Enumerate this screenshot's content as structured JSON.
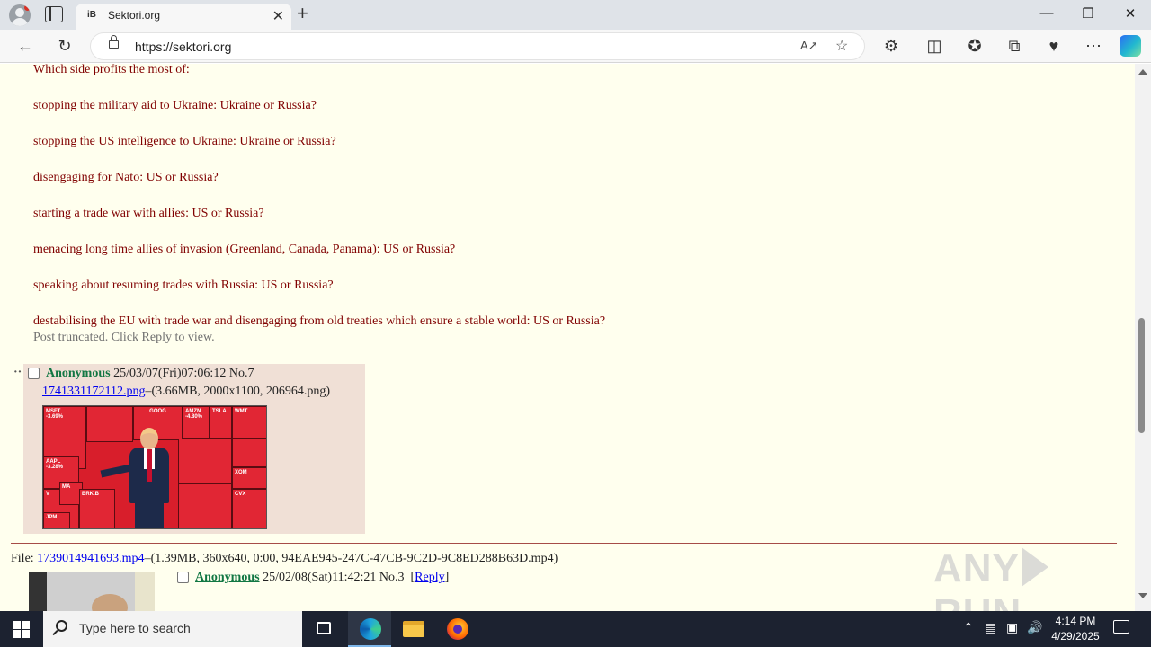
{
  "browser": {
    "tab_title": "Sektori.org",
    "tab_favicon": "iB",
    "url": "https://sektori.org",
    "new_tab_symbol": "+",
    "close_symbol": "✕"
  },
  "post": {
    "lines": [
      "Which side profits the most of:",
      "stopping the military aid to Ukraine: Ukraine or Russia?",
      "stopping the US intelligence to Ukraine: Ukraine or Russia?",
      "disengaging for Nato: US or Russia?",
      "starting a trade war with allies: US or Russia?",
      "menacing long time allies of invasion (Greenland, Canada, Panama): US or Russia?",
      "speaking about resuming trades with Russia: US or Russia?",
      "destabilising the EU with trade war and disengaging from old treaties which ensure a stable world: US or Russia?"
    ],
    "truncated_note": "Post truncated. Click Reply to view."
  },
  "reply_post": {
    "marker": "··",
    "name": "Anonymous",
    "datetime": "25/03/07(Fri)07:06:12",
    "number": "No.7",
    "file_name": "1741331172112.png",
    "file_info": "–(3.66MB, 2000x1100, 206964.png)",
    "thumb_labels": [
      "MSFT",
      "-3.69%",
      "GOOG",
      "AMZN",
      "-4.80%",
      "TSLA",
      "AAPL",
      "-3.28%",
      "MA",
      "V",
      "XOM",
      "CVX",
      "JPM",
      "BRK.B",
      "WMT"
    ]
  },
  "next_thread": {
    "file_label": "File:",
    "file_name": "1739014941693.mp4",
    "file_info": "–(1.39MB, 360x640, 0:00, 94EAE945-247C-47CB-9C2D-9C8ED288B63D.mp4)",
    "name": "Anonymous",
    "datetime": "25/02/08(Sat)11:42:21",
    "number": "No.3",
    "reply_link": "Reply"
  },
  "watermark": {
    "left": "ANY",
    "right": "RUN"
  },
  "taskbar": {
    "search_placeholder": "Type here to search",
    "time": "4:14 PM",
    "date": "4/29/2025"
  },
  "colors": {
    "page_bg": "#ffffee",
    "post_text": "#800000",
    "reply_bg": "#f0e0d6",
    "name_green": "#117743",
    "link_blue": "#0000ee"
  }
}
